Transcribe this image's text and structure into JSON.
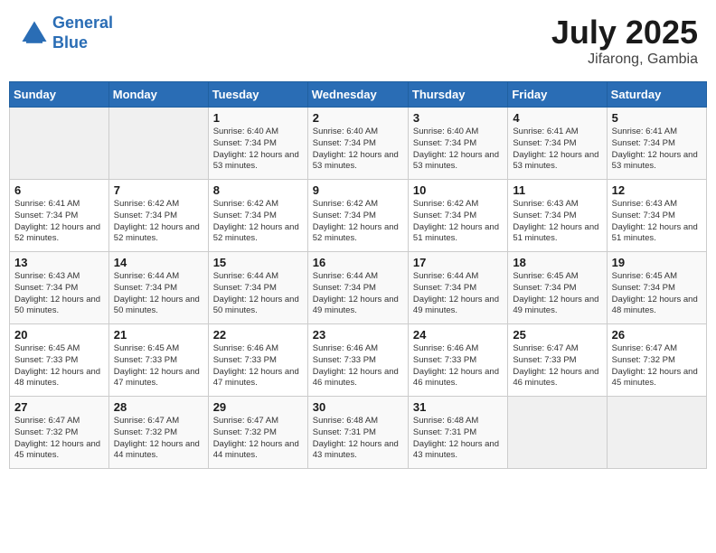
{
  "header": {
    "logo_line1": "General",
    "logo_line2": "Blue",
    "month": "July 2025",
    "location": "Jifarong, Gambia"
  },
  "days_of_week": [
    "Sunday",
    "Monday",
    "Tuesday",
    "Wednesday",
    "Thursday",
    "Friday",
    "Saturday"
  ],
  "weeks": [
    [
      {
        "day": "",
        "sunrise": "",
        "sunset": "",
        "daylight": ""
      },
      {
        "day": "",
        "sunrise": "",
        "sunset": "",
        "daylight": ""
      },
      {
        "day": "1",
        "sunrise": "Sunrise: 6:40 AM",
        "sunset": "Sunset: 7:34 PM",
        "daylight": "Daylight: 12 hours and 53 minutes."
      },
      {
        "day": "2",
        "sunrise": "Sunrise: 6:40 AM",
        "sunset": "Sunset: 7:34 PM",
        "daylight": "Daylight: 12 hours and 53 minutes."
      },
      {
        "day": "3",
        "sunrise": "Sunrise: 6:40 AM",
        "sunset": "Sunset: 7:34 PM",
        "daylight": "Daylight: 12 hours and 53 minutes."
      },
      {
        "day": "4",
        "sunrise": "Sunrise: 6:41 AM",
        "sunset": "Sunset: 7:34 PM",
        "daylight": "Daylight: 12 hours and 53 minutes."
      },
      {
        "day": "5",
        "sunrise": "Sunrise: 6:41 AM",
        "sunset": "Sunset: 7:34 PM",
        "daylight": "Daylight: 12 hours and 53 minutes."
      }
    ],
    [
      {
        "day": "6",
        "sunrise": "Sunrise: 6:41 AM",
        "sunset": "Sunset: 7:34 PM",
        "daylight": "Daylight: 12 hours and 52 minutes."
      },
      {
        "day": "7",
        "sunrise": "Sunrise: 6:42 AM",
        "sunset": "Sunset: 7:34 PM",
        "daylight": "Daylight: 12 hours and 52 minutes."
      },
      {
        "day": "8",
        "sunrise": "Sunrise: 6:42 AM",
        "sunset": "Sunset: 7:34 PM",
        "daylight": "Daylight: 12 hours and 52 minutes."
      },
      {
        "day": "9",
        "sunrise": "Sunrise: 6:42 AM",
        "sunset": "Sunset: 7:34 PM",
        "daylight": "Daylight: 12 hours and 52 minutes."
      },
      {
        "day": "10",
        "sunrise": "Sunrise: 6:42 AM",
        "sunset": "Sunset: 7:34 PM",
        "daylight": "Daylight: 12 hours and 51 minutes."
      },
      {
        "day": "11",
        "sunrise": "Sunrise: 6:43 AM",
        "sunset": "Sunset: 7:34 PM",
        "daylight": "Daylight: 12 hours and 51 minutes."
      },
      {
        "day": "12",
        "sunrise": "Sunrise: 6:43 AM",
        "sunset": "Sunset: 7:34 PM",
        "daylight": "Daylight: 12 hours and 51 minutes."
      }
    ],
    [
      {
        "day": "13",
        "sunrise": "Sunrise: 6:43 AM",
        "sunset": "Sunset: 7:34 PM",
        "daylight": "Daylight: 12 hours and 50 minutes."
      },
      {
        "day": "14",
        "sunrise": "Sunrise: 6:44 AM",
        "sunset": "Sunset: 7:34 PM",
        "daylight": "Daylight: 12 hours and 50 minutes."
      },
      {
        "day": "15",
        "sunrise": "Sunrise: 6:44 AM",
        "sunset": "Sunset: 7:34 PM",
        "daylight": "Daylight: 12 hours and 50 minutes."
      },
      {
        "day": "16",
        "sunrise": "Sunrise: 6:44 AM",
        "sunset": "Sunset: 7:34 PM",
        "daylight": "Daylight: 12 hours and 49 minutes."
      },
      {
        "day": "17",
        "sunrise": "Sunrise: 6:44 AM",
        "sunset": "Sunset: 7:34 PM",
        "daylight": "Daylight: 12 hours and 49 minutes."
      },
      {
        "day": "18",
        "sunrise": "Sunrise: 6:45 AM",
        "sunset": "Sunset: 7:34 PM",
        "daylight": "Daylight: 12 hours and 49 minutes."
      },
      {
        "day": "19",
        "sunrise": "Sunrise: 6:45 AM",
        "sunset": "Sunset: 7:34 PM",
        "daylight": "Daylight: 12 hours and 48 minutes."
      }
    ],
    [
      {
        "day": "20",
        "sunrise": "Sunrise: 6:45 AM",
        "sunset": "Sunset: 7:33 PM",
        "daylight": "Daylight: 12 hours and 48 minutes."
      },
      {
        "day": "21",
        "sunrise": "Sunrise: 6:45 AM",
        "sunset": "Sunset: 7:33 PM",
        "daylight": "Daylight: 12 hours and 47 minutes."
      },
      {
        "day": "22",
        "sunrise": "Sunrise: 6:46 AM",
        "sunset": "Sunset: 7:33 PM",
        "daylight": "Daylight: 12 hours and 47 minutes."
      },
      {
        "day": "23",
        "sunrise": "Sunrise: 6:46 AM",
        "sunset": "Sunset: 7:33 PM",
        "daylight": "Daylight: 12 hours and 46 minutes."
      },
      {
        "day": "24",
        "sunrise": "Sunrise: 6:46 AM",
        "sunset": "Sunset: 7:33 PM",
        "daylight": "Daylight: 12 hours and 46 minutes."
      },
      {
        "day": "25",
        "sunrise": "Sunrise: 6:47 AM",
        "sunset": "Sunset: 7:33 PM",
        "daylight": "Daylight: 12 hours and 46 minutes."
      },
      {
        "day": "26",
        "sunrise": "Sunrise: 6:47 AM",
        "sunset": "Sunset: 7:32 PM",
        "daylight": "Daylight: 12 hours and 45 minutes."
      }
    ],
    [
      {
        "day": "27",
        "sunrise": "Sunrise: 6:47 AM",
        "sunset": "Sunset: 7:32 PM",
        "daylight": "Daylight: 12 hours and 45 minutes."
      },
      {
        "day": "28",
        "sunrise": "Sunrise: 6:47 AM",
        "sunset": "Sunset: 7:32 PM",
        "daylight": "Daylight: 12 hours and 44 minutes."
      },
      {
        "day": "29",
        "sunrise": "Sunrise: 6:47 AM",
        "sunset": "Sunset: 7:32 PM",
        "daylight": "Daylight: 12 hours and 44 minutes."
      },
      {
        "day": "30",
        "sunrise": "Sunrise: 6:48 AM",
        "sunset": "Sunset: 7:31 PM",
        "daylight": "Daylight: 12 hours and 43 minutes."
      },
      {
        "day": "31",
        "sunrise": "Sunrise: 6:48 AM",
        "sunset": "Sunset: 7:31 PM",
        "daylight": "Daylight: 12 hours and 43 minutes."
      },
      {
        "day": "",
        "sunrise": "",
        "sunset": "",
        "daylight": ""
      },
      {
        "day": "",
        "sunrise": "",
        "sunset": "",
        "daylight": ""
      }
    ]
  ]
}
